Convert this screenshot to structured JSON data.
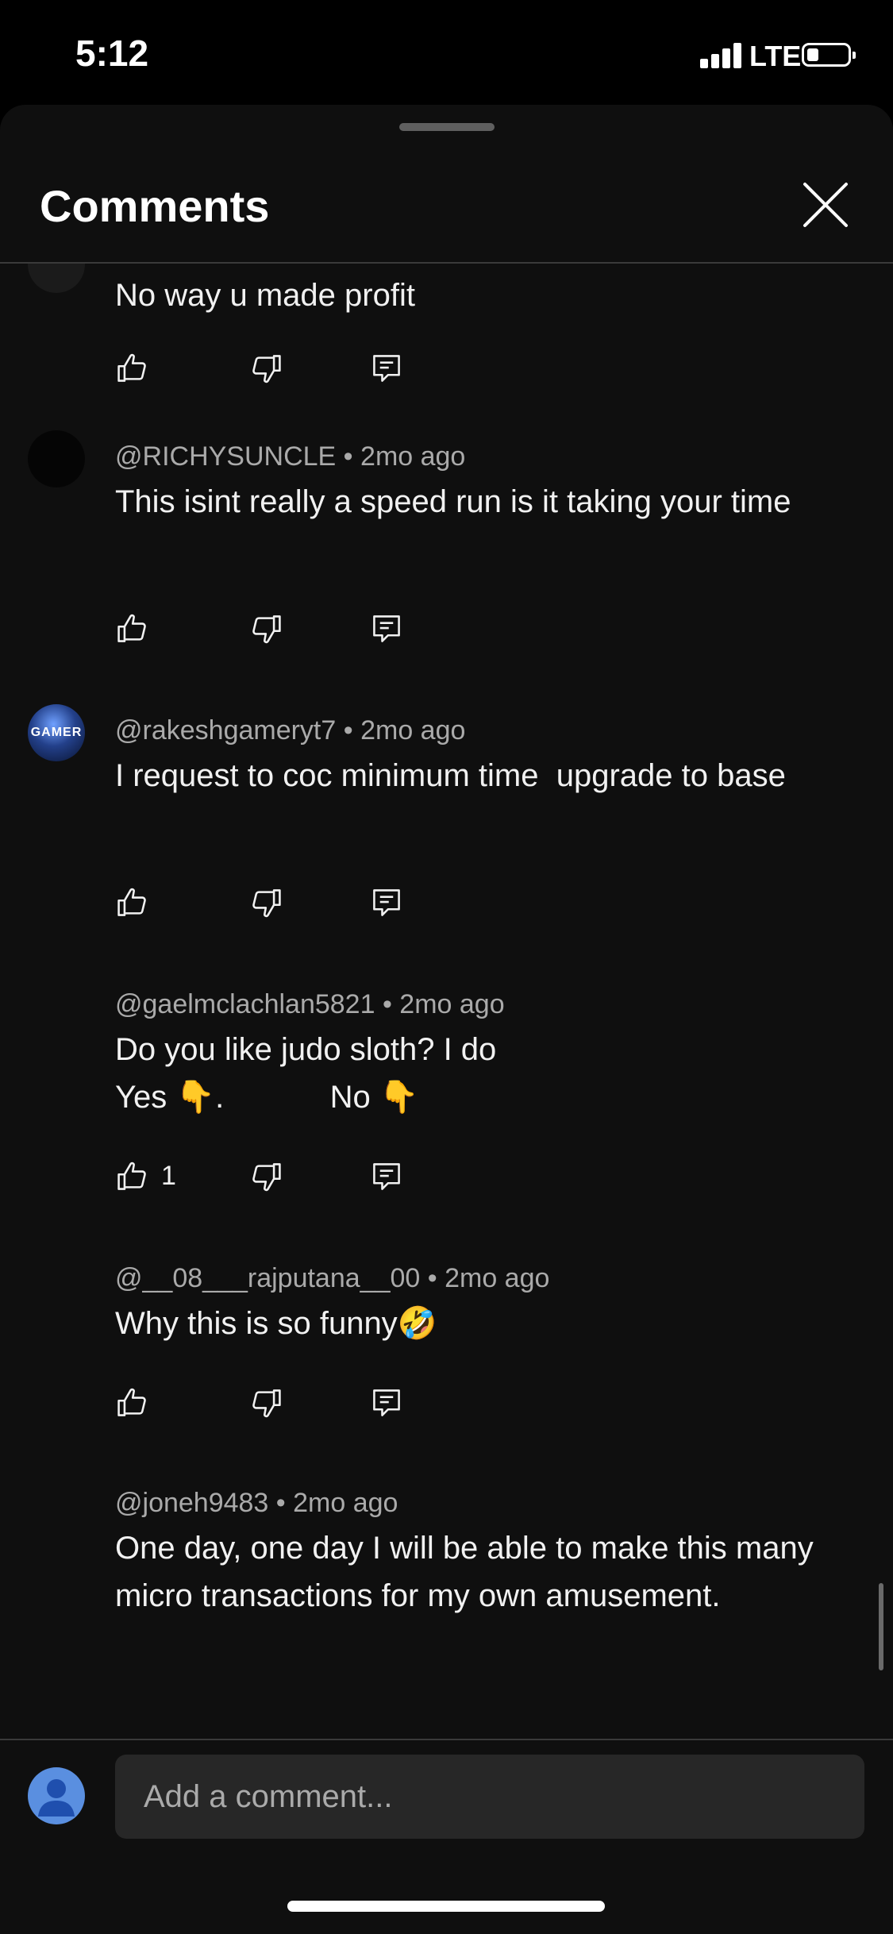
{
  "status": {
    "time": "5:12",
    "network": "LTE"
  },
  "header": {
    "title": "Comments"
  },
  "comments": [
    {
      "author": "",
      "age": "",
      "text": "No way u made profit",
      "likes": ""
    },
    {
      "author": "@RICHYSUNCLE",
      "age": "2mo ago",
      "text": "This isint really a speed run is it taking your time",
      "likes": ""
    },
    {
      "author": "@rakeshgameryt7",
      "age": "2mo ago",
      "text": "I request to coc minimum time  upgrade to base",
      "likes": ""
    },
    {
      "author": "@gaelmclachlan5821",
      "age": "2mo ago",
      "text": "Do you like judo sloth? I do\nYes 👇.            No 👇",
      "likes": "1"
    },
    {
      "author": "@__08___rajputana__00",
      "age": "2mo ago",
      "text": "Why this is so funny🤣",
      "likes": ""
    },
    {
      "author": "@joneh9483",
      "age": "2mo ago",
      "text": "One day, one day I will be able to make this many micro transactions for my own amusement.",
      "likes": ""
    }
  ],
  "avatar_badge": "GAMER",
  "composer": {
    "placeholder": "Add a comment..."
  },
  "colors": {
    "background": "#0f0f0f",
    "text": "#f1f1f1",
    "secondary": "#aaaaaa",
    "avatar_blue": "#5a8fe0"
  },
  "icons": {
    "like": "thumb-up-icon",
    "dislike": "thumb-down-icon",
    "reply": "reply-icon",
    "close": "close-icon"
  }
}
